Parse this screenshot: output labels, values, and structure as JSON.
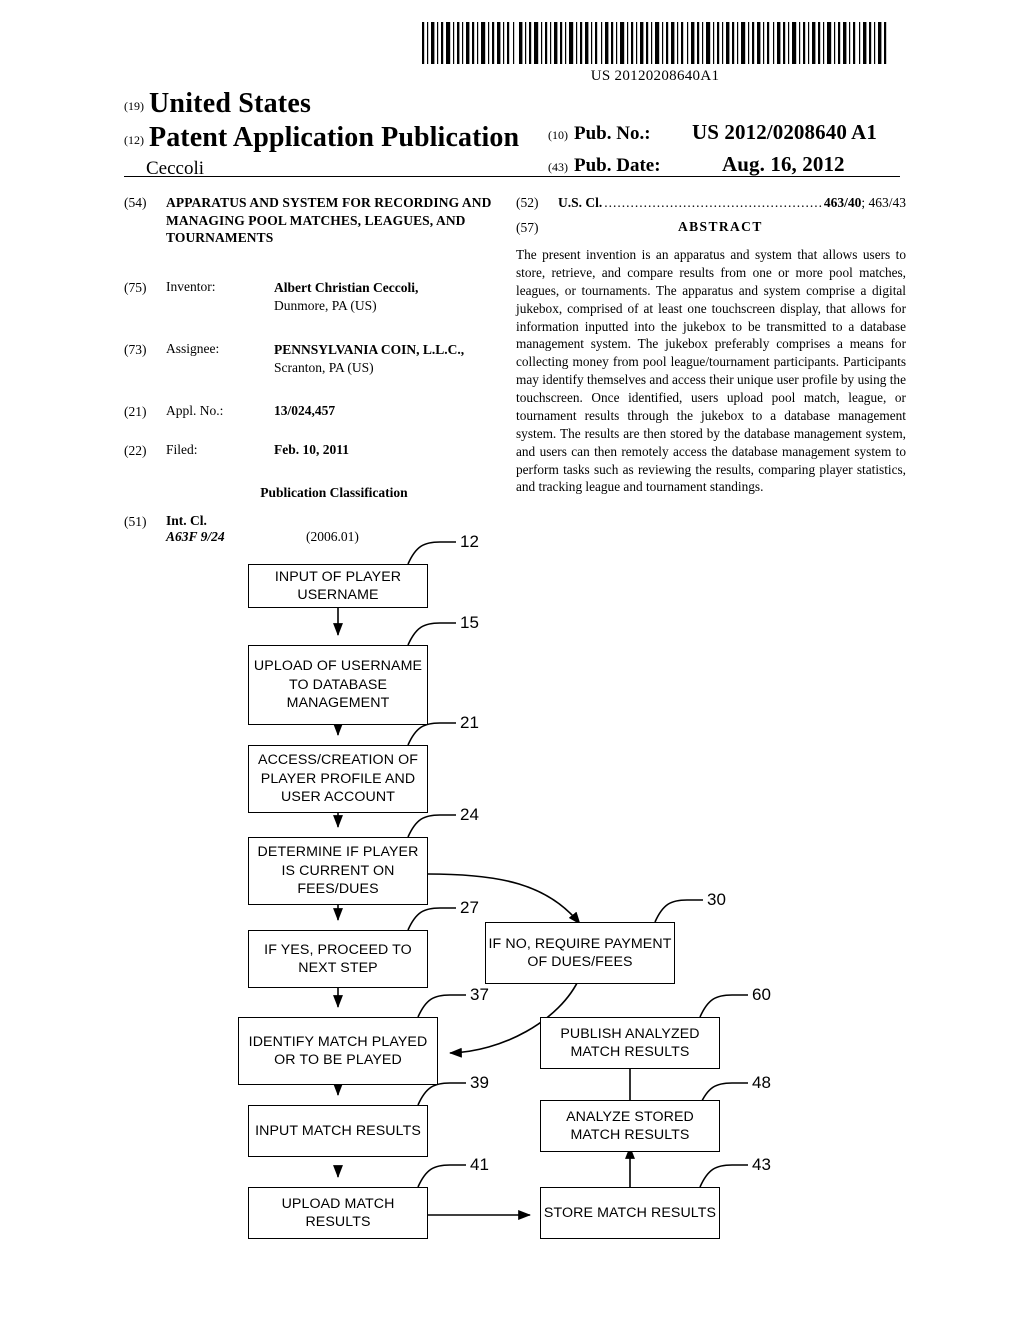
{
  "barcode": {
    "number": "US 20120208640A1"
  },
  "header": {
    "tag_country": "(19)",
    "country": "United States",
    "tag_doc_type": "(12)",
    "doc_type": "Patent Application Publication",
    "inventor_surname": "Ceccoli",
    "tag_pub_no": "(10)",
    "pub_no_label": "Pub. No.:",
    "pub_no_value": "US 2012/0208640 A1",
    "tag_pub_date": "(43)",
    "pub_date_label": "Pub. Date:",
    "pub_date_value": "Aug. 16, 2012"
  },
  "biblio": {
    "title_tag": "(54)",
    "title": "APPARATUS AND SYSTEM FOR RECORDING AND MANAGING POOL MATCHES, LEAGUES, AND TOURNAMENTS",
    "inventor_tag": "(75)",
    "inventor_label": "Inventor:",
    "inventor_name": "Albert Christian Ceccoli,",
    "inventor_address": "Dunmore, PA (US)",
    "assignee_tag": "(73)",
    "assignee_label": "Assignee:",
    "assignee_name": "PENNSYLVANIA COIN, L.L.C.,",
    "assignee_address": "Scranton, PA (US)",
    "appl_no_tag": "(21)",
    "appl_no_label": "Appl. No.:",
    "appl_no_value": "13/024,457",
    "filed_tag": "(22)",
    "filed_label": "Filed:",
    "filed_value": "Feb. 10, 2011",
    "pub_class_heading": "Publication Classification",
    "int_cl_tag": "(51)",
    "int_cl_label": "Int. Cl.",
    "int_cl_code": "A63F  9/24",
    "int_cl_version": "(2006.01)"
  },
  "right_column": {
    "us_cl_tag": "(52)",
    "us_cl_label": "U.S. Cl.",
    "us_cl_dots": "................................................................",
    "us_cl_value_primary": "463/40",
    "us_cl_value_secondary": "; 463/43",
    "abstract_tag": "(57)",
    "abstract_heading": "ABSTRACT",
    "abstract_text": "The present invention is an apparatus and system that allows users to store, retrieve, and compare results from one or more pool matches, leagues, or tournaments. The apparatus and system comprise a digital jukebox, comprised of at least one touchscreen display, that allows for information inputted into the jukebox to be transmitted to a database management system. The jukebox preferably comprises a means for collecting money from pool league/tournament participants. Participants may identify themselves and access their unique user profile by using the touchscreen. Once identified, users upload pool match, league, or tournament results through the jukebox to a database management system. The results are then stored by the database management system, and users can then remotely access the database management system to perform tasks such as reviewing the results, comparing player statistics, and tracking league and tournament standings."
  },
  "flowchart": {
    "boxes": [
      {
        "ref": "12",
        "label": "INPUT OF PLAYER USERNAME"
      },
      {
        "ref": "15",
        "label": "UPLOAD OF USERNAME TO DATABASE MANAGEMENT"
      },
      {
        "ref": "21",
        "label": "ACCESS/CREATION OF PLAYER PROFILE AND USER ACCOUNT"
      },
      {
        "ref": "24",
        "label": "DETERMINE IF PLAYER IS CURRENT ON FEES/DUES"
      },
      {
        "ref": "27",
        "label": "IF YES, PROCEED TO NEXT STEP"
      },
      {
        "ref": "30",
        "label": "IF NO, REQUIRE PAYMENT OF DUES/FEES"
      },
      {
        "ref": "37",
        "label": "IDENTIFY MATCH PLAYED OR TO BE PLAYED"
      },
      {
        "ref": "39",
        "label": "INPUT MATCH RESULTS"
      },
      {
        "ref": "41",
        "label": "UPLOAD MATCH RESULTS"
      },
      {
        "ref": "43",
        "label": "STORE MATCH RESULTS"
      },
      {
        "ref": "48",
        "label": "ANALYZE STORED MATCH RESULTS"
      },
      {
        "ref": "60",
        "label": "PUBLISH ANALYZED MATCH RESULTS"
      }
    ]
  }
}
